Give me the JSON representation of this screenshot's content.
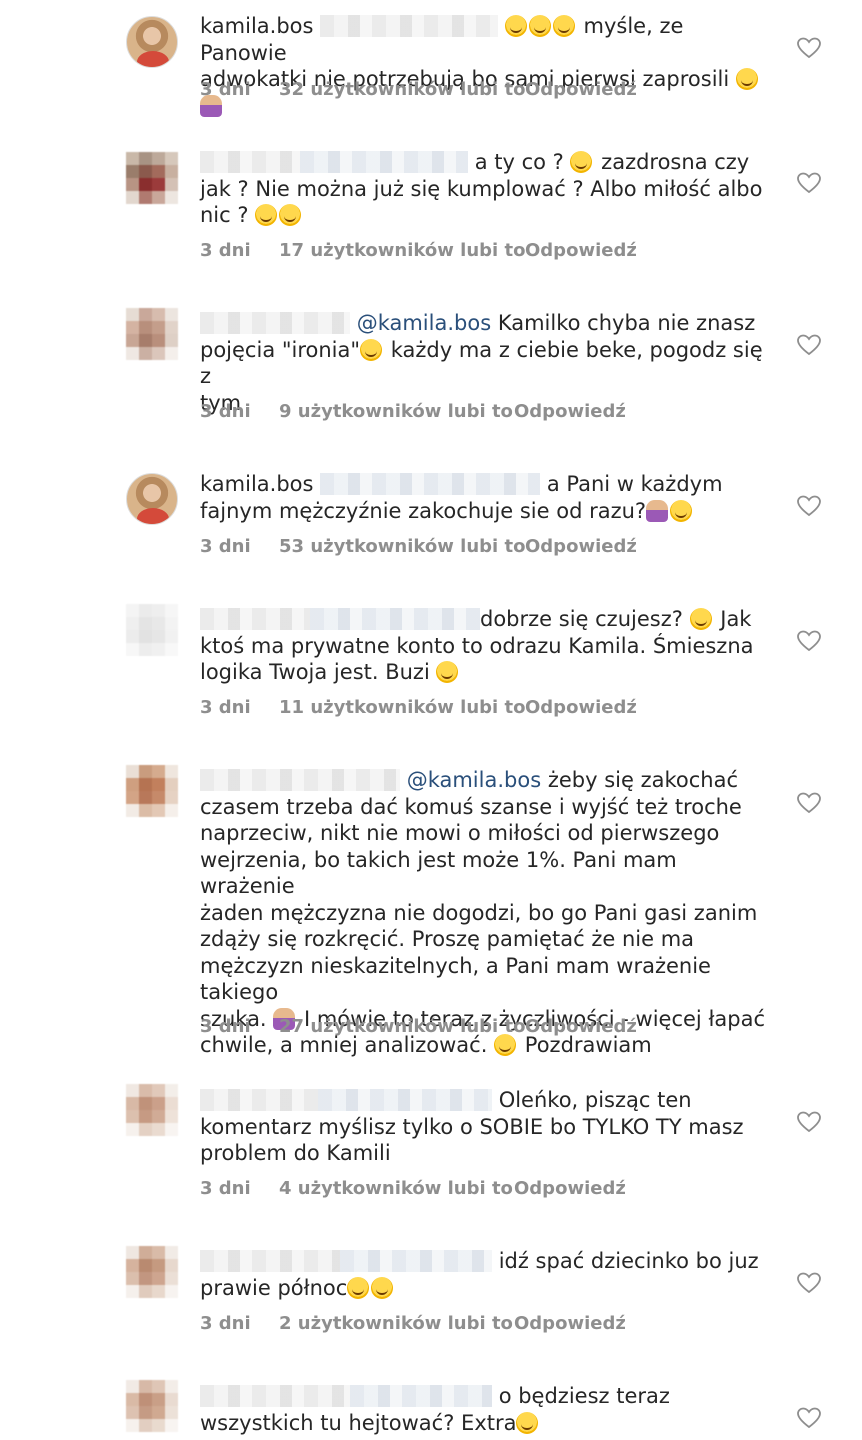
{
  "comments": [
    {
      "username": "kamila.bos",
      "text_lines": [
        "myśle, ze Panowie",
        "adwokatki nie potrzebują bo sami pierwsi zaprosili"
      ],
      "time": "3 dni",
      "likes": "32 użytkowników lubi to",
      "reply": "Odpowiedź"
    },
    {
      "username": "",
      "text_lines": [
        "a ty co ?",
        "zazdrosna czy",
        "jak ? Nie można już się kumplować ? Albo miłość albo",
        "nic ?"
      ],
      "time": "3 dni",
      "likes": "17 użytkowników lubi to",
      "reply": "Odpowiedź"
    },
    {
      "username": "",
      "mention": "@kamila.bos",
      "text_lines": [
        "Kamilko chyba nie znasz",
        "pojęcia \"ironia\"",
        "każdy ma z ciebie beke, pogodz się z",
        "tym"
      ],
      "time": "3 dni",
      "likes": "9 użytkowników lubi to",
      "reply": "Odpowiedź"
    },
    {
      "username": "kamila.bos",
      "text_lines": [
        "a Pani w każdym",
        "fajnym mężczyźnie zakochuje sie od razu?"
      ],
      "time": "3 dni",
      "likes": "53 użytkowników lubi to",
      "reply": "Odpowiedź"
    },
    {
      "username": "",
      "text_lines": [
        "dobrze się czujesz?",
        "Jak",
        "ktoś ma prywatne konto to odrazu Kamila. Śmieszna",
        "logika Twoja jest. Buzi"
      ],
      "time": "3 dni",
      "likes": "11 użytkowników lubi to",
      "reply": "Odpowiedź"
    },
    {
      "username": "",
      "mention": "@kamila.bos",
      "text_lines": [
        "żeby się zakochać",
        "czasem trzeba dać komuś szanse i wyjść też troche",
        "naprzeciw, nikt nie mowi o miłości od pierwszego",
        "wejrzenia, bo takich jest może 1%. Pani mam wrażenie",
        "żaden mężczyzna nie dogodzi, bo go Pani gasi zanim",
        "zdąży się rozkręcić. Proszę pamiętać że nie ma",
        "mężczyzn nieskazitelnych, a Pani mam wrażenie takiego",
        "szuka.",
        "I mówię to teraz z życzliwości - więcej łapać",
        "chwile, a mniej analizować.",
        "Pozdrawiam"
      ],
      "time": "3 dni",
      "likes": "27 użytkowników lubi to",
      "reply": "Odpowiedź"
    },
    {
      "username": "",
      "text_lines": [
        "Oleńko, pisząc ten",
        "komentarz myślisz tylko o SOBIE bo TYLKO TY  masz",
        "problem do Kamili"
      ],
      "time": "3 dni",
      "likes": "4 użytkowników lubi to",
      "reply": "Odpowiedź"
    },
    {
      "username": "",
      "text_lines": [
        "idź spać dziecinko bo juz",
        "prawie północ"
      ],
      "time": "3 dni",
      "likes": "2 użytkowników lubi to",
      "reply": "Odpowiedź"
    },
    {
      "username": "",
      "text_lines": [
        "o będziesz teraz",
        "wszystkich tu hejtować? Extra"
      ]
    }
  ],
  "icons": {
    "like": "heart-outline-icon",
    "avatar_real": "profile-photo",
    "avatar_hidden": "pixelated-avatar"
  },
  "colors": {
    "text": "#262626",
    "meta": "#8e8e8e",
    "mention": "#2a4f7a",
    "background": "#ffffff"
  }
}
